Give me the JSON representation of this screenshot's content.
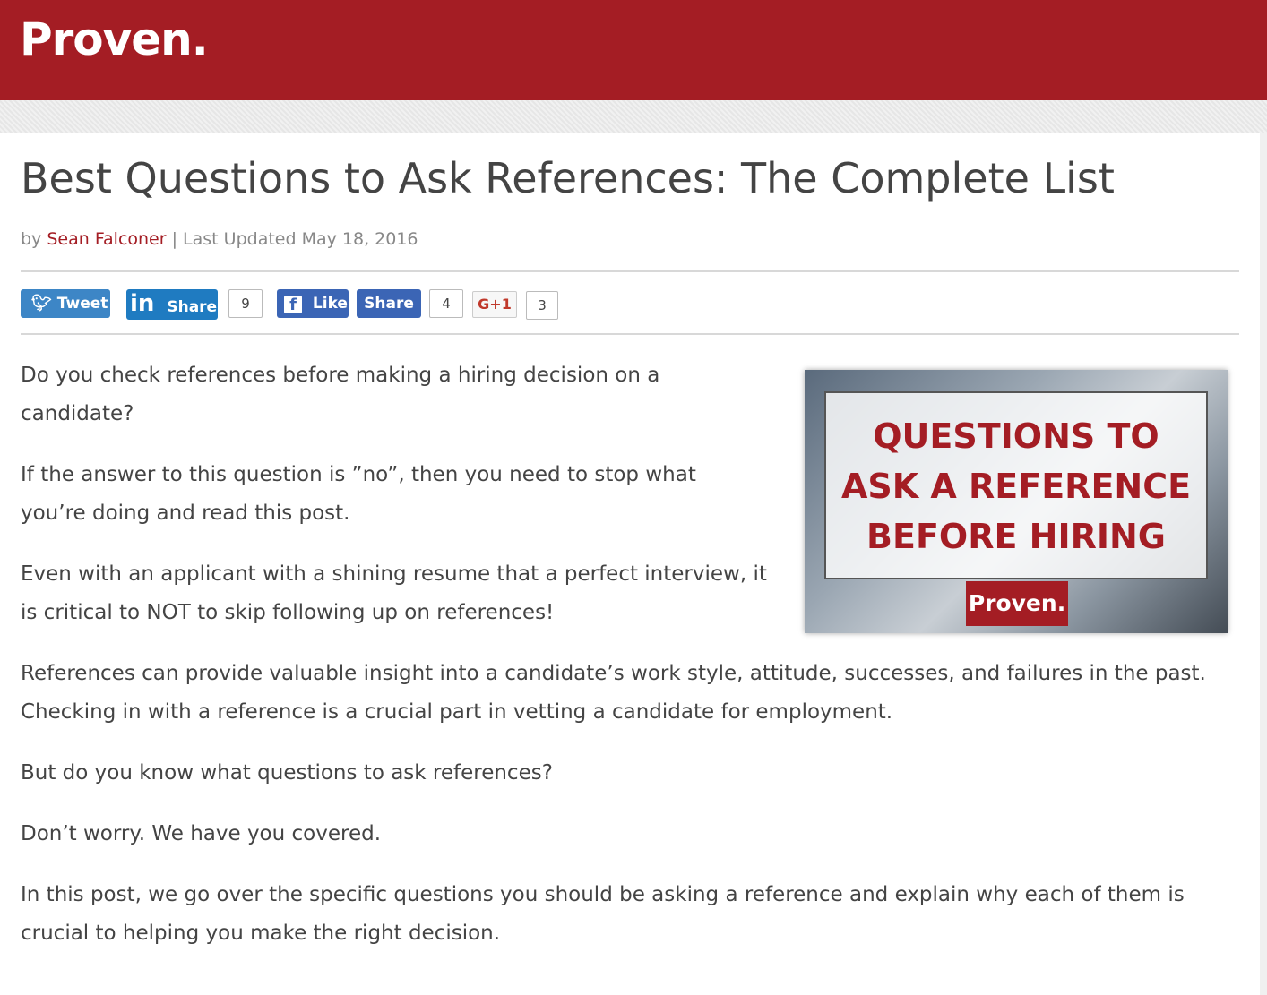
{
  "header": {
    "logo_text": "Proven."
  },
  "article": {
    "title": "Best Questions to Ask References: The Complete List",
    "byline": {
      "by": "by ",
      "author": "Sean Falconer",
      "separator": " | ",
      "updated": "Last Updated May 18, 2016"
    },
    "share": {
      "tweet_label": "Tweet",
      "linkedin_label": "Share",
      "linkedin_icon": "in",
      "linkedin_count": "9",
      "facebook_like_label": "Like",
      "facebook_icon": "f",
      "facebook_share_label": "Share",
      "facebook_count": "4",
      "gplus_label": "G+1",
      "gplus_count": "3",
      "colors": {
        "twitter": "#3d86c6",
        "linkedin": "#1f7bc1",
        "facebook": "#3b65b5"
      }
    },
    "feature_image": {
      "headline_lines": [
        "QUESTIONS TO",
        "ASK A REFERENCE",
        "BEFORE HIRING"
      ],
      "badge": "Proven."
    },
    "paragraphs": [
      "Do you check references before making a hiring decision on a candidate?",
      "If the answer to this question is ”no”, then you need to stop what you’re doing and read this post.",
      "Even with an applicant with a shining resume that a perfect interview, it is critical to NOT to skip following up on references!",
      "References can provide valuable insight into a candidate’s work style, attitude, successes, and failures in the past. Checking in with a reference is a crucial part in vetting a candidate for employment.",
      "But do you know what questions to ask references?",
      "Don’t worry. We have you covered.",
      "In this post, we go over the specific questions you should be asking a reference and explain why each of them is crucial to helping you make the right decision."
    ]
  },
  "colors": {
    "brand": "#a41d24",
    "text": "#444444"
  }
}
